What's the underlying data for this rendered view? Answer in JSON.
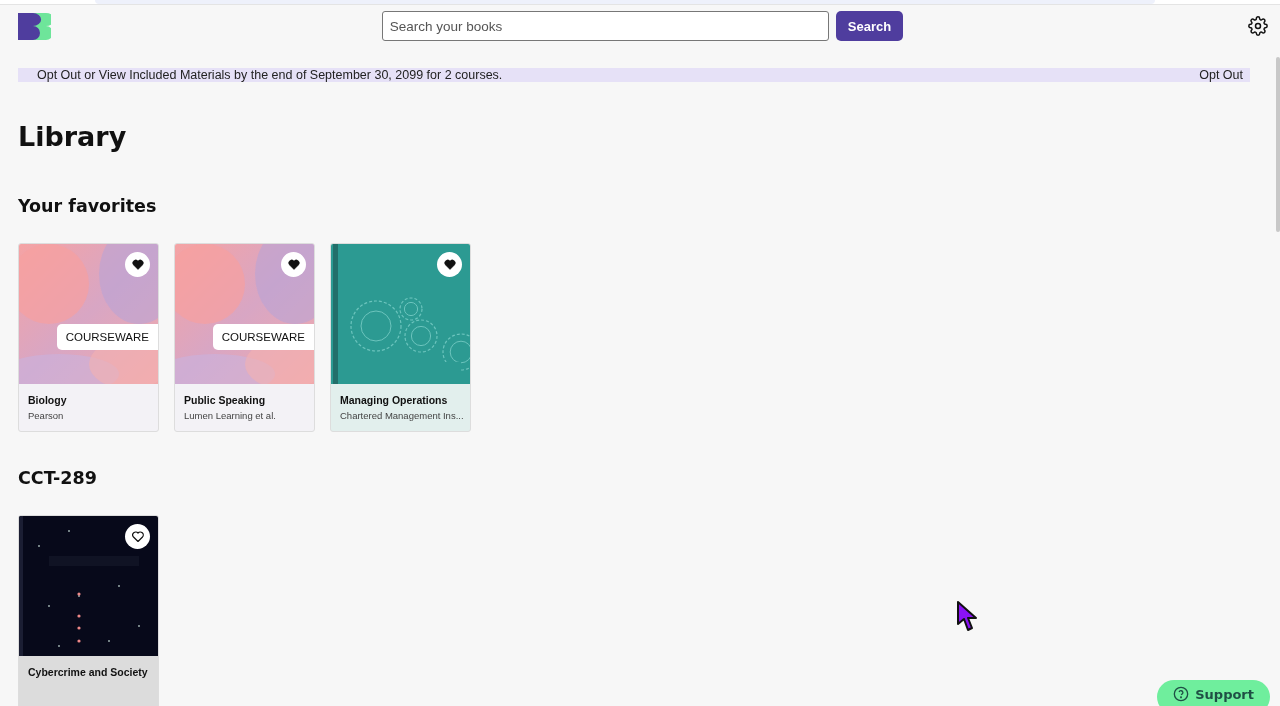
{
  "header": {
    "search": {
      "placeholder": "Search your books"
    },
    "search_button": "Search"
  },
  "banner": {
    "message": "Opt Out or View Included Materials by the end of September 30, 2099 for 2 courses.",
    "action": "Opt Out"
  },
  "title": "Library",
  "sections": [
    {
      "heading": "Your favorites",
      "books": [
        {
          "title": "Biology",
          "author": "Pearson",
          "kind": "courseware",
          "badge": "COURSEWARE",
          "favorite": true
        },
        {
          "title": "Public Speaking",
          "author": "Lumen Learning et al.",
          "kind": "courseware",
          "badge": "COURSEWARE",
          "favorite": true
        },
        {
          "title": "Managing Operations",
          "author": "Chartered Management Ins...",
          "kind": "gears",
          "favorite": true
        }
      ]
    },
    {
      "heading": "CCT-289",
      "books": [
        {
          "title": "Cybercrime and Society",
          "kind": "stars",
          "favorite": false
        }
      ]
    }
  ],
  "support_button": "Support"
}
